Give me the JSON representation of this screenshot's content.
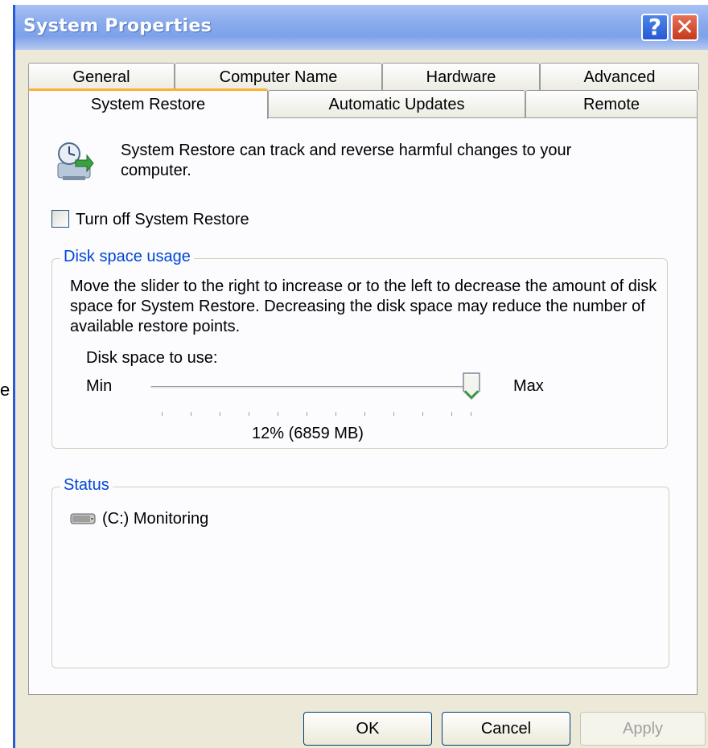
{
  "window": {
    "title": "System Properties",
    "help_glyph": "?",
    "close_glyph": "✕",
    "stray_char": "e"
  },
  "tabs": {
    "row1": [
      "General",
      "Computer Name",
      "Hardware",
      "Advanced"
    ],
    "row2": [
      "System Restore",
      "Automatic Updates",
      "Remote"
    ],
    "active": "System Restore"
  },
  "intro": {
    "icon": "system-restore-icon",
    "text": "System Restore can track and reverse harmful changes to your computer."
  },
  "turn_off": {
    "label": "Turn off System Restore",
    "checked": false
  },
  "disk_usage": {
    "legend": "Disk space usage",
    "description": "Move the slider to the right to increase or to the left to decrease the amount of disk space for System Restore. Decreasing the disk space may reduce the number of available restore points.",
    "slider_label": "Disk space to use:",
    "min_label": "Min",
    "max_label": "Max",
    "value_text": "12% (6859 MB)",
    "slider_level": 1.0
  },
  "status": {
    "legend": "Status",
    "drive_icon": "hard-drive-icon",
    "drive_text": "(C:) Monitoring"
  },
  "buttons": {
    "ok": "OK",
    "cancel": "Cancel",
    "apply": "Apply"
  },
  "colors": {
    "titlebar": "#8cadee",
    "dialog_bg": "#ece9d8",
    "legend_blue": "#0046d5",
    "active_tab_accent": "#f8b233"
  }
}
